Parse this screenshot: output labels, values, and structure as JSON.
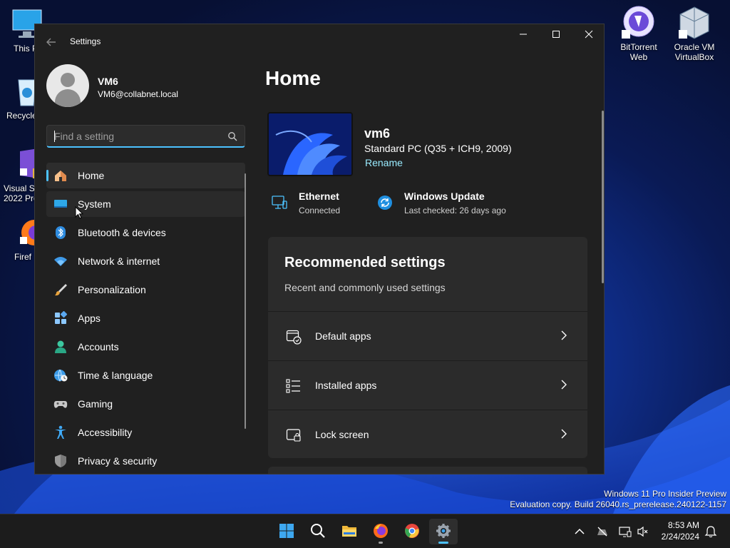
{
  "desktop": {
    "icons": [
      {
        "name": "this-pc",
        "label": "This P"
      },
      {
        "name": "recycle-bin",
        "label": "Recycle"
      },
      {
        "name": "visual-studio",
        "label": "Visual St\n2022 Pre"
      },
      {
        "name": "firefox",
        "label": "Firef"
      },
      {
        "name": "bittorrent",
        "label": "BitTorrent\nWeb"
      },
      {
        "name": "virtualbox",
        "label": "Oracle VM\nVirtualBox"
      }
    ],
    "watermark": {
      "line1": "Windows 11 Pro Insider Preview",
      "line2": "Evaluation copy. Build 26040.rs_prerelease.240122-1157"
    }
  },
  "window": {
    "title": "Settings",
    "controls": {
      "minimize": "—",
      "maximize": "☐",
      "close": "✕"
    }
  },
  "user": {
    "name": "VM6",
    "email": "VM6@collabnet.local"
  },
  "search": {
    "placeholder": "Find a setting",
    "value": ""
  },
  "nav": {
    "items": [
      {
        "label": "Home",
        "icon": "home-icon",
        "active": true
      },
      {
        "label": "System",
        "icon": "system-icon"
      },
      {
        "label": "Bluetooth & devices",
        "icon": "bluetooth-icon"
      },
      {
        "label": "Network & internet",
        "icon": "wifi-icon"
      },
      {
        "label": "Personalization",
        "icon": "paintbrush-icon"
      },
      {
        "label": "Apps",
        "icon": "apps-icon"
      },
      {
        "label": "Accounts",
        "icon": "accounts-icon"
      },
      {
        "label": "Time & language",
        "icon": "globe-clock-icon"
      },
      {
        "label": "Gaming",
        "icon": "gamepad-icon"
      },
      {
        "label": "Accessibility",
        "icon": "accessibility-icon"
      },
      {
        "label": "Privacy & security",
        "icon": "shield-icon"
      }
    ]
  },
  "home": {
    "title": "Home",
    "pc": {
      "name": "vm6",
      "model": "Standard PC (Q35 + ICH9, 2009)",
      "rename": "Rename"
    },
    "status": [
      {
        "title": "Ethernet",
        "sub": "Connected",
        "icon": "ethernet-icon"
      },
      {
        "title": "Windows Update",
        "sub": "Last checked: 26 days ago",
        "icon": "windows-update-icon"
      }
    ],
    "recommended": {
      "title": "Recommended settings",
      "subtitle": "Recent and commonly used settings",
      "rows": [
        {
          "label": "Default apps",
          "icon": "default-apps-icon"
        },
        {
          "label": "Installed apps",
          "icon": "installed-apps-icon"
        },
        {
          "label": "Lock screen",
          "icon": "lock-screen-icon"
        }
      ]
    }
  },
  "taskbar": {
    "apps": [
      {
        "name": "start",
        "icon": "windows-start-icon"
      },
      {
        "name": "search",
        "icon": "search-icon"
      },
      {
        "name": "file-explorer",
        "icon": "folder-icon"
      },
      {
        "name": "firefox",
        "icon": "firefox-icon"
      },
      {
        "name": "chrome",
        "icon": "chrome-icon"
      },
      {
        "name": "settings",
        "icon": "gear-icon",
        "active": true
      }
    ],
    "clock": {
      "time": "8:53 AM",
      "date": "2/24/2024"
    }
  },
  "colors": {
    "accent": "#4cc2ff",
    "window_bg": "#202020",
    "card_bg": "#2b2b2b",
    "link": "#99ebff"
  }
}
